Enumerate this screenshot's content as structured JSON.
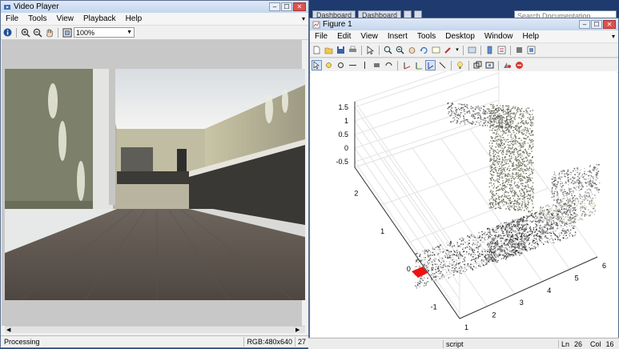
{
  "background": {
    "tabs": [
      "Dashboard",
      "Dashboard",
      "",
      ""
    ],
    "search_placeholder": "Search Documentation",
    "status": {
      "mode": "script",
      "ln_label": "Ln",
      "ln": "26",
      "col_label": "Col",
      "col": "16"
    }
  },
  "video_player": {
    "title": "Video Player",
    "menus": [
      "File",
      "Tools",
      "View",
      "Playback",
      "Help"
    ],
    "zoom": "100%",
    "status": {
      "text": "Processing",
      "info": "RGB:480x640",
      "frame": "27"
    }
  },
  "figure": {
    "title": "Figure 1",
    "menus": [
      "File",
      "Edit",
      "View",
      "Insert",
      "Tools",
      "Desktop",
      "Window",
      "Help"
    ],
    "chart_data": {
      "type": "scatter3d",
      "z_ticks": [
        "1.5",
        "1",
        "0.5",
        "0",
        "-0.5"
      ],
      "y_ticks": [
        "2",
        "1",
        "0",
        "-1"
      ],
      "x_ticks": [
        "1",
        "2",
        "3",
        "4",
        "5",
        "6"
      ],
      "zlim": [
        -0.7,
        1.7
      ],
      "ylim": [
        -1.5,
        2.5
      ],
      "xlim": [
        1,
        6
      ],
      "grid": true
    }
  }
}
